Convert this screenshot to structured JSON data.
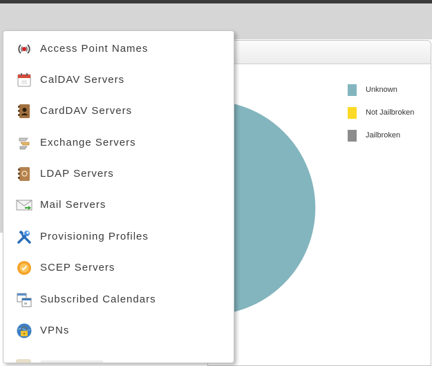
{
  "chart_data": {
    "type": "pie",
    "categories": [
      "Unknown",
      "Jailbroken",
      "Not Jailbroken"
    ],
    "values": [
      75.0,
      3.0,
      22.0
    ],
    "colors": [
      "#83b5be",
      "#8c8c8c",
      "#fcda27"
    ],
    "legend": [
      {
        "label": "Unknown",
        "color": "#83b5be"
      },
      {
        "label": "Not Jailbroken",
        "color": "#fcda27"
      },
      {
        "label": "Jailbroken",
        "color": "#8c8c8c"
      }
    ],
    "legend_position": "top-right"
  },
  "menu": {
    "items": [
      {
        "label": "Access Point Names",
        "icon": "antenna-icon"
      },
      {
        "label": "CalDAV Servers",
        "icon": "calendar-icon"
      },
      {
        "label": "CardDAV Servers",
        "icon": "address-book-icon"
      },
      {
        "label": "Exchange Servers",
        "icon": "exchange-icon"
      },
      {
        "label": "LDAP Servers",
        "icon": "directory-book-icon"
      },
      {
        "label": "Mail Servers",
        "icon": "envelope-icon"
      },
      {
        "label": "Provisioning Profiles",
        "icon": "tools-icon"
      },
      {
        "label": "SCEP Servers",
        "icon": "certificate-seal-icon"
      },
      {
        "label": "Subscribed Calendars",
        "icon": "subscribed-calendar-icon"
      },
      {
        "label": "VPNs",
        "icon": "vpn-lock-icon"
      }
    ]
  }
}
